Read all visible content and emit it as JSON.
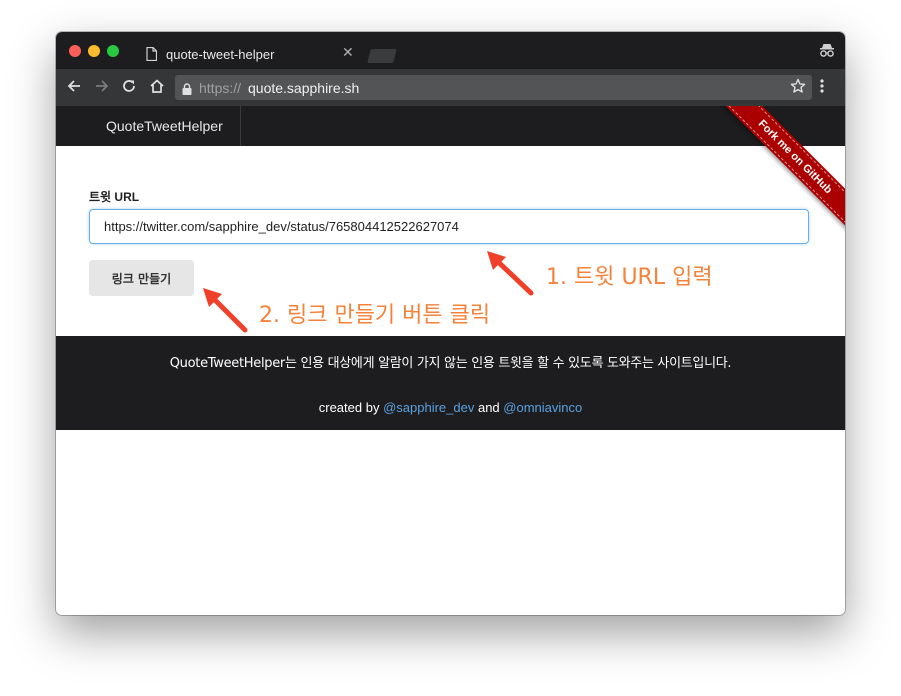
{
  "browser": {
    "tab_title": "quote-tweet-helper",
    "url_scheme": "https://",
    "url_host": "quote.sapphire.sh"
  },
  "navbar": {
    "brand": "QuoteTweetHelper"
  },
  "ribbon": {
    "label": "Fork me on GitHub",
    "color": "#aa0000"
  },
  "form": {
    "label": "트윗 URL",
    "input_value": "https://twitter.com/sapphire_dev/status/765804412522627074",
    "button_label": "링크 만들기"
  },
  "footer": {
    "description": "QuoteTweetHelper는 인용 대상에게 알람이 가지 않는 인용 트윗을 할 수 있도록 도와주는 사이트입니다.",
    "created_by": "created by",
    "author1": "@sapphire_dev",
    "and": "and",
    "author2": "@omniavinco"
  },
  "annotations": {
    "step1": "1. 트윗 URL 입력",
    "step2": "2. 링크 만들기 버튼 클릭",
    "color": "#f5823a"
  },
  "icons": [
    "document-icon",
    "close-icon",
    "back-arrow-icon",
    "forward-arrow-icon",
    "reload-icon",
    "home-icon",
    "lock-icon",
    "star-icon",
    "menu-dots-icon",
    "incognito-icon"
  ]
}
